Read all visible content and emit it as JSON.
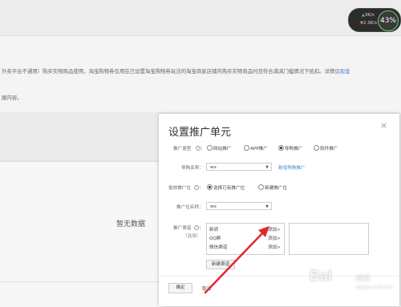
{
  "background": {
    "notice_prefix": "外卖平台不通用）购买实物商品使用，淘宝购物券仅用在已设置淘宝购物券玩法的淘宝商家店铺内购买实物商品时且符合满减门槛情况下抵扣。详情见",
    "notice_link": "现金",
    "notice_line2": "圈内容。",
    "no_data": "暂无数据"
  },
  "speed_widget": {
    "up": "3K/s",
    "down": "2.3K/s",
    "percent": "43%"
  },
  "dialog": {
    "title": "设置推广单元",
    "close_label": "×",
    "promo_type": {
      "label": "推广类型",
      "options": [
        "网站推广",
        "APP推广",
        "导购推广",
        "软件推广"
      ],
      "selected": "导购推广"
    },
    "guide_name": {
      "label": "导购名称：",
      "value": "wx",
      "new_link": "新增导购推广"
    },
    "placement": {
      "label": "投放推广位",
      "options": [
        "选择已有推广位",
        "新建推广位"
      ],
      "selected": "选择已有推广位"
    },
    "placement_name": {
      "label": "推广位名称：",
      "value": "wx"
    },
    "channel": {
      "label": "推广渠道",
      "optional": "（选填）",
      "items": [
        {
          "name": "新浪",
          "action": "添加>"
        },
        {
          "name": "QQ群",
          "action": "添加>"
        },
        {
          "name": "微信渠道",
          "action": "添加>"
        }
      ],
      "new_button": "新建渠道"
    },
    "confirm": "确定",
    "cancel": "取消"
  },
  "watermark": {
    "brand": "Bai",
    "text": "经验",
    "url": "jingyan.baidu.com"
  },
  "colors": {
    "link": "#3b7fd4",
    "arrow": "#e0282e",
    "speed_ring": "#6ad06a"
  }
}
